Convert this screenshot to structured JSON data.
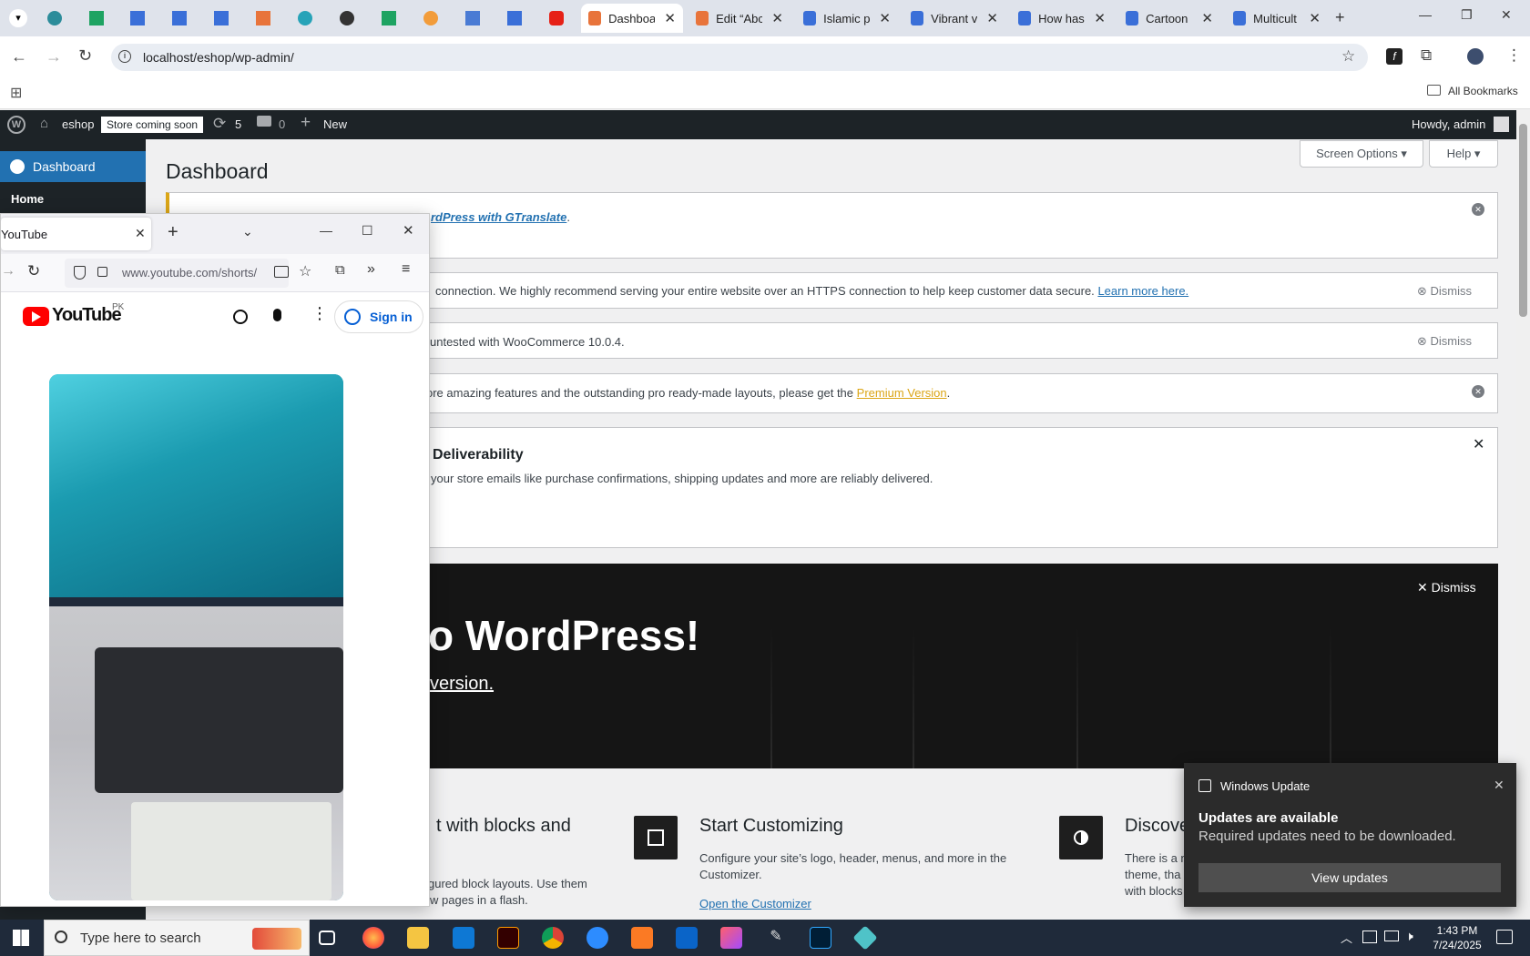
{
  "browser": {
    "tabs": [
      {
        "title": "Dashboa",
        "active": true,
        "color": "#e8743b"
      },
      {
        "title": "Edit “Abc",
        "active": false,
        "color": "#e8743b"
      },
      {
        "title": "Islamic p",
        "active": false,
        "color": "#3a6fd8"
      },
      {
        "title": "Vibrant v",
        "active": false,
        "color": "#3a6fd8"
      },
      {
        "title": "How has",
        "active": false,
        "color": "#3a6fd8"
      },
      {
        "title": "Cartoon",
        "active": false,
        "color": "#3a6fd8"
      },
      {
        "title": "Multicult",
        "active": false,
        "color": "#3a6fd8"
      }
    ],
    "url": "localhost/eshop/wp-admin/",
    "bookmarks_label": "All Bookmarks"
  },
  "adminbar": {
    "site": "eshop",
    "store_badge": "Store coming soon",
    "updates": "5",
    "comments": "0",
    "new": "New",
    "howdy": "Howdy, admin"
  },
  "sidebar": {
    "dashboard": "Dashboard",
    "home": "Home"
  },
  "main": {
    "title": "Dashboard",
    "screen_options": "Screen Options ▾",
    "help": "Help ▾",
    "notice1_link": "rdPress with GTranslate",
    "notice1_tail": ".",
    "notice2_text": "connection. We highly recommend serving your entire website over an HTTPS connection to help keep customer data secure.",
    "notice2_link": "Learn more here.",
    "notice3_text": "untested with WooCommerce 10.0.4.",
    "notice4_text": "ore amazing features and the outstanding pro ready-made layouts, please get the",
    "notice4_link": "Premium Version",
    "notice4_tail": ".",
    "deliver_title": "Deliverability",
    "deliver_text": "your store emails like purchase confirmations, shipping updates and more are reliably delivered.",
    "dismiss": "Dismiss",
    "welcome_title": "o WordPress!",
    "welcome_link": "version.",
    "welcome_dismiss": "Dismiss",
    "card1_title": "t with blocks and",
    "card1_text": "gured block layouts. Use them",
    "card1_text2": "w pages in a flash.",
    "card2_title": "Start Customizing",
    "card2_text": "Configure your site’s logo, header, menus, and more in the Customizer.",
    "card2_link": "Open the Customizer",
    "card3_title": "Discove",
    "card3_text": "There is a n",
    "card3_text2": "theme, tha",
    "card3_text3": "with blocks"
  },
  "firefox": {
    "tab_title": "YouTube",
    "url": "www.youtube.com/shorts/",
    "yt_region": "PK",
    "yt_signin": "Sign in",
    "yt_logo": "YouTube"
  },
  "toast": {
    "app": "Windows Update",
    "title": "Updates are available",
    "body": "Required updates need to be downloaded.",
    "button": "View updates"
  },
  "taskbar": {
    "search_placeholder": "Type here to search",
    "time": "1:43 PM",
    "date": "7/24/2025"
  }
}
